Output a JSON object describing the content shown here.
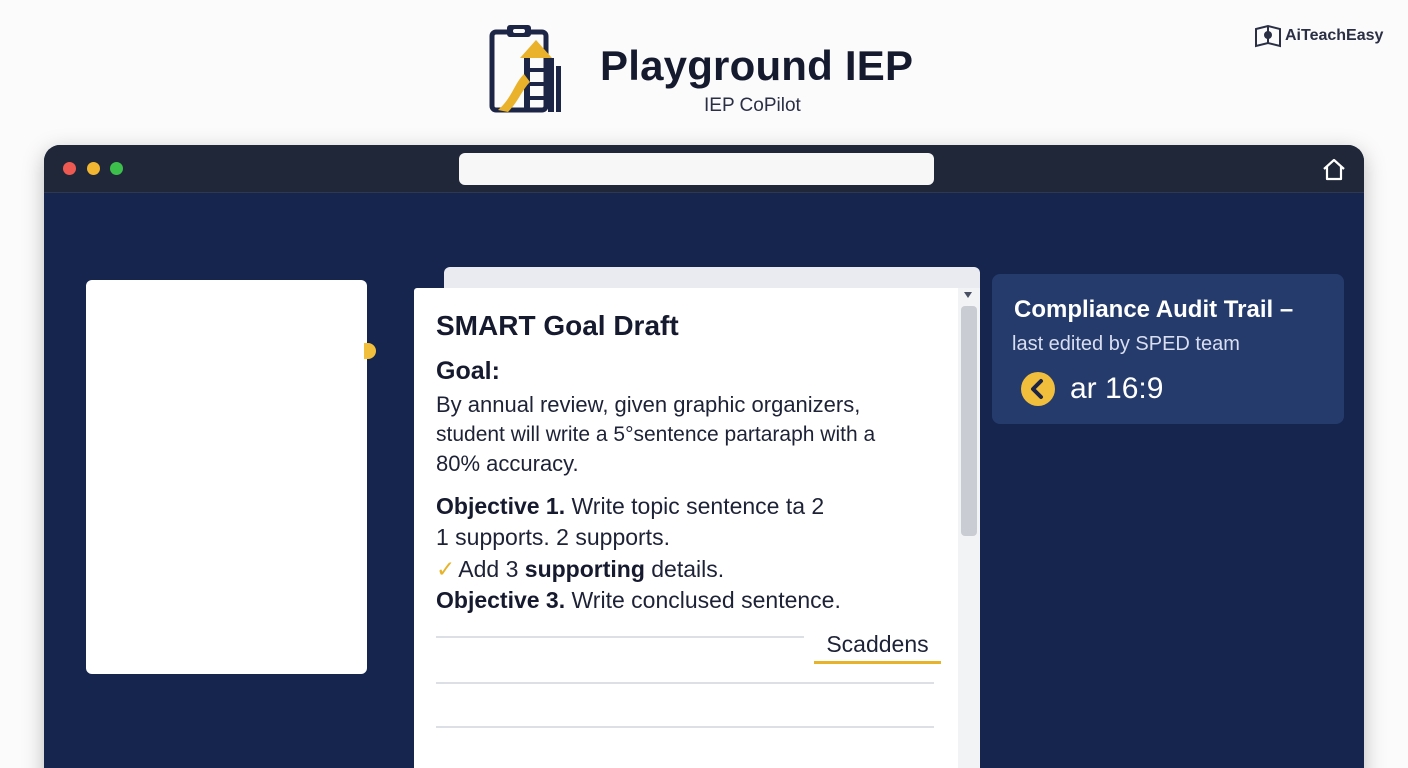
{
  "header": {
    "app_title": "Playground IEP",
    "app_subtitle": "IEP CoPilot",
    "corner_brand": "AiTeachEasy",
    "logo_icon": "clipboard-playground-icon"
  },
  "browser": {
    "traffic_lights": [
      "#ee5a52",
      "#f2b630",
      "#3dbf4b"
    ],
    "address_value": "",
    "home_icon": "home-icon"
  },
  "document": {
    "title": "SMART Goal Draft",
    "goal_heading": "Goal:",
    "goal_lines": [
      "By annual review, given graphic organizers,",
      "student will write a 5°sentence partaraph with a",
      "80% accuracy."
    ],
    "objective1_label": "Objective 1.",
    "objective1_text": "Write topic sentence ta 2",
    "objective1_cont": "1 supports. 2 supports.",
    "check_pre": "Add 3",
    "check_bold": "supporting",
    "check_post": "details.",
    "objective3_label": "Objective 3.",
    "objective3_text": "Write conclused sentence.",
    "link_label": "Scaddens"
  },
  "compliance": {
    "title": "Compliance Audit Trail –",
    "subtitle": "last edited by SPED team",
    "badge_text": "ar 16:9",
    "badge_icon": "chevron-left-circle-icon"
  },
  "colors": {
    "accent": "#e6b32a",
    "navy": "#15254d",
    "card": "#253b6c"
  }
}
